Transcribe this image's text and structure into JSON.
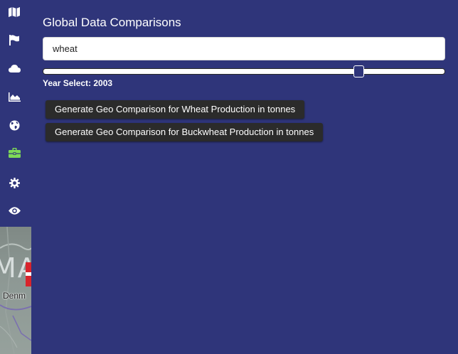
{
  "title": "Global Data Comparisons",
  "search": {
    "value": "wheat",
    "placeholder": ""
  },
  "slider": {
    "label": "Year Select: 2003",
    "position_fraction": 0.794
  },
  "buttons": {
    "wheat": "Generate Geo Comparison for Wheat Production in tonnes",
    "buckwheat": "Generate Geo Comparison for Buckwheat Production in tonnes"
  },
  "sidebar": {
    "items": [
      {
        "icon": "map-icon",
        "active": false
      },
      {
        "icon": "flag-icon",
        "active": false
      },
      {
        "icon": "cloud-icon",
        "active": false
      },
      {
        "icon": "area-chart-icon",
        "active": false
      },
      {
        "icon": "globe-icon",
        "active": false
      },
      {
        "icon": "briefcase-icon",
        "active": true
      },
      {
        "icon": "gear-icon",
        "active": false
      },
      {
        "icon": "eye-icon",
        "active": false
      }
    ],
    "icon_color": "#ffffff",
    "active_color": "#7ed957"
  },
  "map_thumbnail": {
    "large_text": "MA",
    "place_label": "Denm"
  },
  "colors": {
    "background": "#2f357a",
    "button": "#2b2b2b",
    "text": "#ffffff"
  }
}
